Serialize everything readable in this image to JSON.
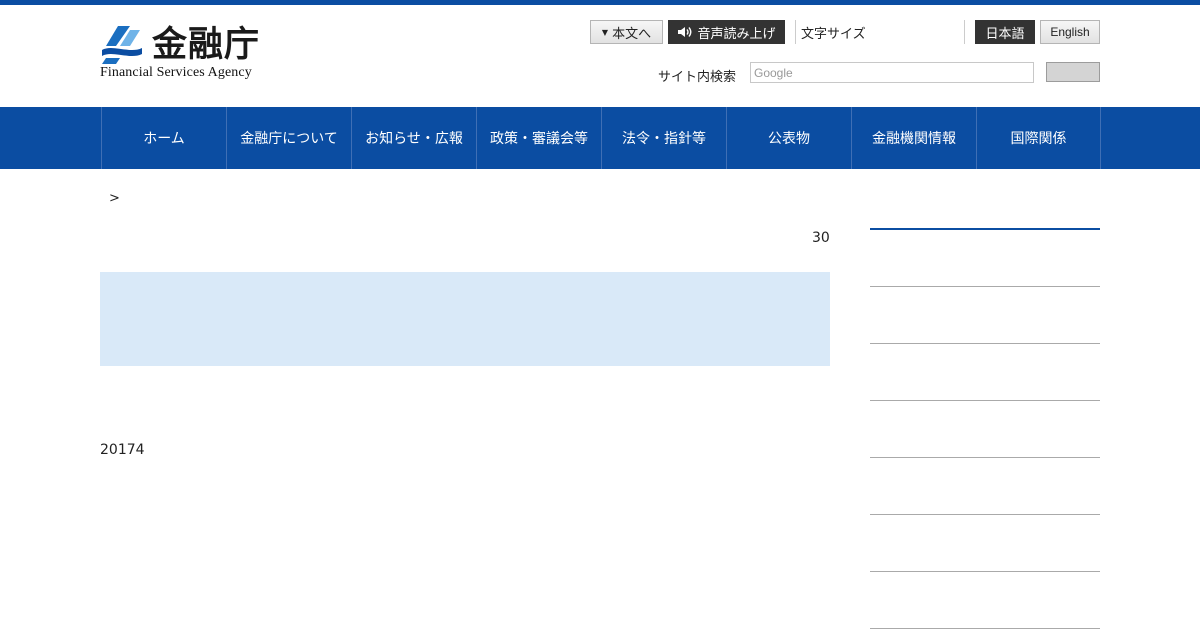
{
  "header": {
    "logo_kanji": "金融庁",
    "logo_en": "Financial Services Agency",
    "skip_label": "本文へ",
    "read_label": "音声読み上げ",
    "text_size_label": "文字サイズ",
    "lang_ja": "日本語",
    "lang_en": "English",
    "search_label": "サイト内検索",
    "search_placeholder": "Google",
    "brand_color": "#0b4da2"
  },
  "nav": {
    "items": [
      {
        "label": "ホーム"
      },
      {
        "label": "金融庁について"
      },
      {
        "label": "お知らせ・広報"
      },
      {
        "label": "政策・審議会等"
      },
      {
        "label": "法令・指針等"
      },
      {
        "label": "公表物"
      },
      {
        "label": "金融機関情報"
      },
      {
        "label": "国際関係"
      }
    ]
  },
  "main": {
    "breadcrumb_sep": ">",
    "date_fragment": "30",
    "body_fragment": "20174",
    "infobox_color": "#d9e9f8"
  }
}
